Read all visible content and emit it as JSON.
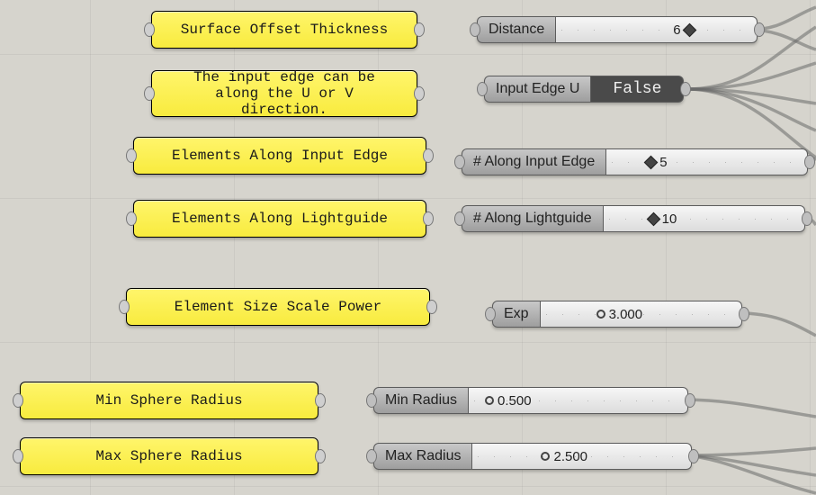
{
  "panels": {
    "surface_offset": "Surface Offset Thickness",
    "input_edge_desc": "The input edge can be along the U or V direction.",
    "elements_input_edge": "Elements Along Input Edge",
    "elements_lightguide": "Elements Along Lightguide",
    "element_size_scale": "Element Size Scale Power",
    "min_sphere_radius": "Min Sphere Radius",
    "max_sphere_radius": "Max Sphere Radius"
  },
  "params": {
    "distance": {
      "label": "Distance",
      "value": "6"
    },
    "input_edge_u": {
      "label": "Input Edge U",
      "value": "False"
    },
    "along_input_edge": {
      "label": "# Along Input Edge",
      "value": "5"
    },
    "along_lightguide": {
      "label": "# Along Lightguide",
      "value": "10"
    },
    "exp": {
      "label": "Exp",
      "value": "3.000"
    },
    "min_radius": {
      "label": "Min Radius",
      "value": "0.500"
    },
    "max_radius": {
      "label": "Max Radius",
      "value": "2.500"
    }
  }
}
